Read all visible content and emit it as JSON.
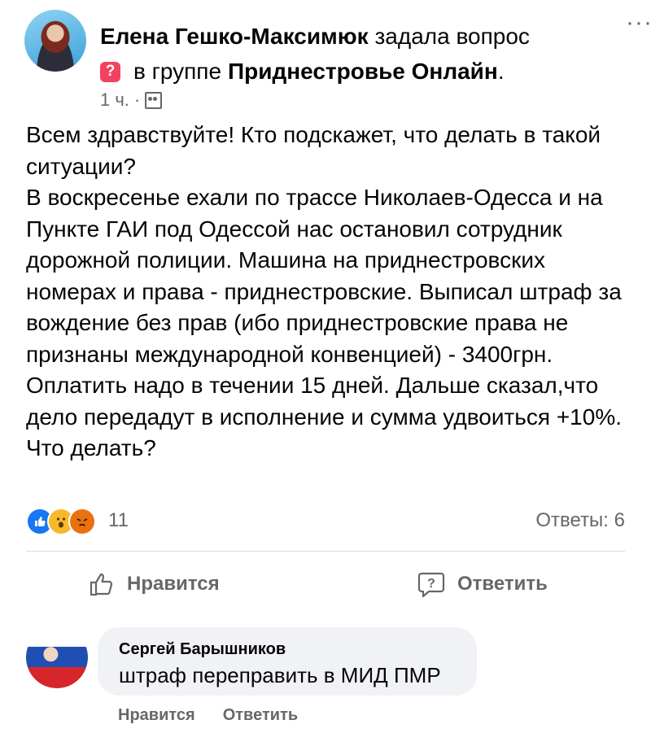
{
  "post": {
    "author_name": "Елена Гешко-Максимюк",
    "action_text": "задала вопрос",
    "question_badge": "?",
    "group_prefix": "в группе",
    "group_name": "Приднестровье Онлайн",
    "group_suffix": ".",
    "time": "1 ч.",
    "time_separator": "·",
    "more_label": "···",
    "text_lines": [
      "Всем здравствуйте! Кто подскажет, что делать в такой ситуации?",
      "В воскресенье ехали по трассе Николаев-Одесса и на Пункте ГАИ под Одессой нас остановил сотрудник дорожной полиции. Машина на приднестровских номерах и права - приднестровские. Выписал штраф за вождение без прав (ибо приднестровские права не признаны международной конвенцией) - 3400грн. Оплатить надо в течении 15 дней. Дальше сказал,что дело передадут в исполнение и сумма удвоиться +10%.",
      "Что делать?"
    ]
  },
  "reactions": {
    "icons": [
      "like-icon",
      "wow-icon",
      "angry-icon"
    ],
    "count": "11",
    "answers_label": "Ответы: 6"
  },
  "actions": {
    "like_label": "Нравится",
    "reply_label": "Ответить"
  },
  "comment": {
    "author": "Сергей Барышников",
    "text": "штраф переправить в МИД ПМР",
    "like_label": "Нравится",
    "reply_label": "Ответить"
  },
  "colors": {
    "accent": "#1877f2",
    "secondary_text": "#65676b",
    "bubble": "#f0f2f5",
    "question_badge": "#f3425f"
  }
}
